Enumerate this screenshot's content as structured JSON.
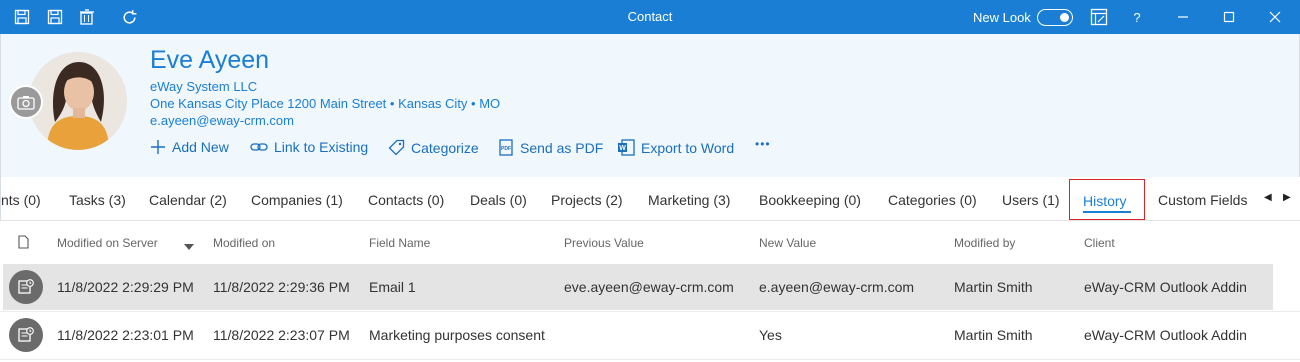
{
  "window": {
    "title": "Contact",
    "new_look_label": "New Look",
    "new_look_enabled": true,
    "help_label": "?"
  },
  "contact": {
    "name": "Eve Ayeen",
    "company": "eWay System LLC",
    "address": "One Kansas City Place 1200 Main Street • Kansas City • MO",
    "email": "e.ayeen@eway-crm.com"
  },
  "actions": [
    {
      "label": "Add New",
      "icon": "plus-icon"
    },
    {
      "label": "Link to Existing",
      "icon": "link-icon"
    },
    {
      "label": "Categorize",
      "icon": "tag-icon"
    },
    {
      "label": "Send as PDF",
      "icon": "pdf-icon"
    },
    {
      "label": "Export to Word",
      "icon": "word-icon"
    },
    {
      "label": "•••",
      "icon": "more-icon"
    }
  ],
  "tabs": [
    {
      "label": "nts (0)"
    },
    {
      "label": "Tasks (3)"
    },
    {
      "label": "Calendar (2)"
    },
    {
      "label": "Companies (1)"
    },
    {
      "label": "Contacts (0)"
    },
    {
      "label": "Deals (0)"
    },
    {
      "label": "Projects (2)"
    },
    {
      "label": "Marketing (3)"
    },
    {
      "label": "Bookkeeping (0)"
    },
    {
      "label": "Categories (0)"
    },
    {
      "label": "Users (1)"
    },
    {
      "label": "History",
      "active": true
    },
    {
      "label": "Custom Fields"
    }
  ],
  "grid": {
    "columns": [
      "Modified on Server",
      "Modified on",
      "Field Name",
      "Previous Value",
      "New Value",
      "Modified by",
      "Client"
    ],
    "sort_column": "Modified on Server",
    "sort_direction": "descending",
    "rows": [
      {
        "modified_on_server": "11/8/2022 2:29:29 PM",
        "modified_on": "11/8/2022 2:29:36 PM",
        "field_name": "Email 1",
        "previous_value": "eve.ayeen@eway-crm.com",
        "new_value": "e.ayeen@eway-crm.com",
        "modified_by": "Martin Smith",
        "client": "eWay-CRM Outlook Addin",
        "selected": true
      },
      {
        "modified_on_server": "11/8/2022 2:23:01 PM",
        "modified_on": "11/8/2022 2:23:07 PM",
        "field_name": "Marketing purposes consent",
        "previous_value": "",
        "new_value": "Yes",
        "modified_by": "Martin Smith",
        "client": "eWay-CRM Outlook Addin",
        "selected": false
      }
    ]
  },
  "colors": {
    "accent": "#1a7fd4",
    "header_bg": "#f0f7fd",
    "active_tab_frame": "#d9242b",
    "selected_row": "#e4e4e4"
  }
}
